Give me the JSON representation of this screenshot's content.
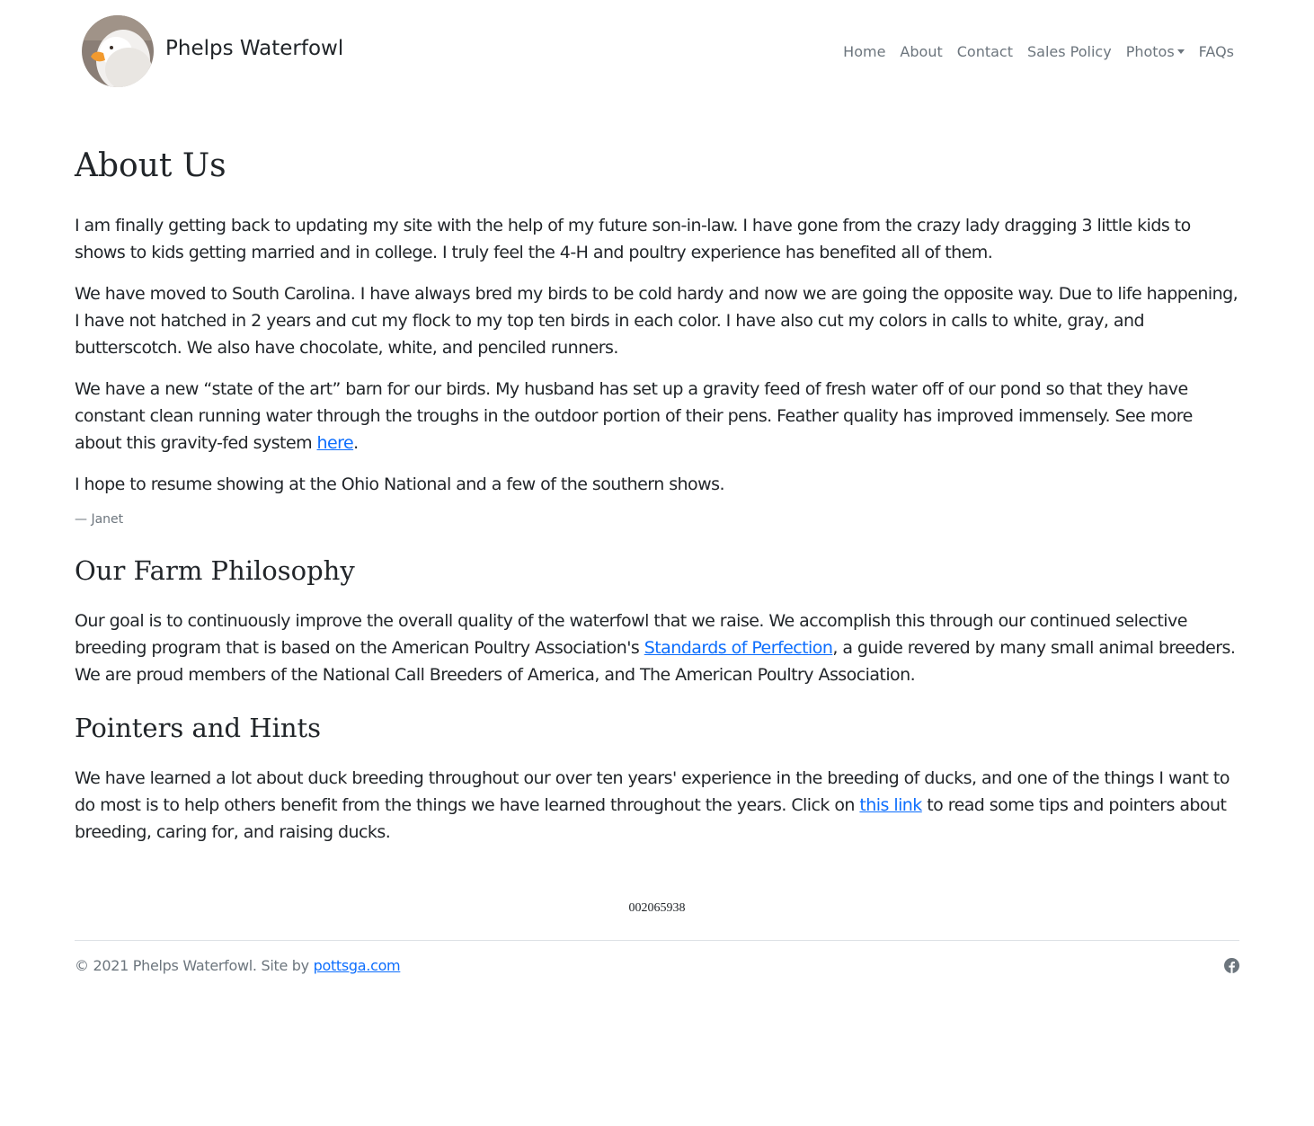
{
  "header": {
    "brand": "Phelps Waterfowl",
    "logo_alt": "duck-logo",
    "nav": [
      "Home",
      "About",
      "Contact",
      "Sales Policy",
      "Photos",
      "FAQs"
    ]
  },
  "about": {
    "title": "About Us",
    "p1": "I am finally getting back to updating my site with the help of my future son-in-law. I have gone from the crazy lady dragging 3 little kids to shows to kids getting married and in college. I truly feel the 4-H and poultry experience has benefited all of them.",
    "p2": "We have moved to South Carolina. I have always bred my birds to be cold hardy and now we are going the opposite way. Due to life happening, I have not hatched in 2 years and cut my flock to my top ten birds in each color. I have also cut my colors in calls to white, gray, and butterscotch. We also have chocolate, white, and penciled runners.",
    "p3_before": "We have a new “state of the art” barn for our birds. My husband has set up a gravity feed of fresh water off of our pond so that they have constant clean running water through the troughs in the outdoor portion of their pens. Feather quality has improved immensely. See more about this gravity-fed system ",
    "p3_link": "here",
    "p3_after": ".",
    "p4": "I hope to resume showing at the Ohio National and a few of the southern shows.",
    "signature": "— Janet"
  },
  "philosophy": {
    "title": "Our Farm Philosophy",
    "text_before": "Our goal is to continuously improve the overall quality of the waterfowl that we raise. We accomplish this through our continued selective breeding program that is based on the American Poultry Association's ",
    "link": "Standards of Perfection",
    "text_after": ", a guide revered by many small animal breeders. We are proud members of the National Call Breeders of America, and The American Poultry Association."
  },
  "pointers": {
    "title": "Pointers and Hints",
    "text_before": "We have learned a lot about duck breeding throughout our over ten years' experience in the breeding of ducks, and one of the things I want to do most is to help others benefit from the things we have learned throughout the years. Click on ",
    "link": "this link",
    "text_after": " to read some tips and pointers about breeding, caring for, and raising ducks."
  },
  "counter": "002065938",
  "footer": {
    "copyright": "© 2021 Phelps Waterfowl. Site by ",
    "link": "pottsga.com",
    "social_icon": "facebook-icon"
  },
  "colors": {
    "link": "#0d6efd",
    "muted": "#6c757d",
    "text": "#212529"
  }
}
